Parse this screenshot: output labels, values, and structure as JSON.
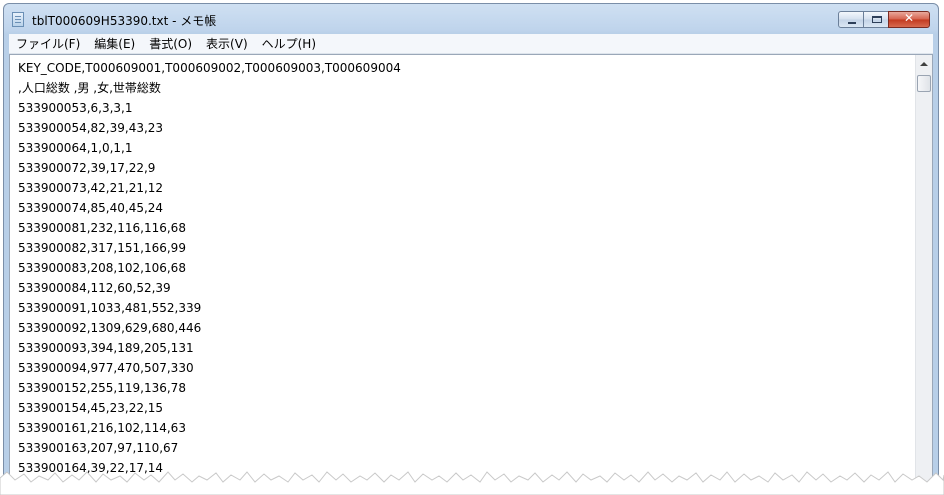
{
  "window": {
    "title": "tblT000609H53390.txt - メモ帳",
    "close_glyph": "✕"
  },
  "menu": [
    {
      "label": "ファイル(F)"
    },
    {
      "label": "編集(E)"
    },
    {
      "label": "書式(O)"
    },
    {
      "label": "表示(V)"
    },
    {
      "label": "ヘルプ(H)"
    }
  ],
  "document": {
    "lines": [
      "KEY_CODE,T000609001,T000609002,T000609003,T000609004",
      ",人口総数 ,男 ,女,世帯総数",
      "533900053,6,3,3,1",
      "533900054,82,39,43,23",
      "533900064,1,0,1,1",
      "533900072,39,17,22,9",
      "533900073,42,21,21,12",
      "533900074,85,40,45,24",
      "533900081,232,116,116,68",
      "533900082,317,151,166,99",
      "533900083,208,102,106,68",
      "533900084,112,60,52,39",
      "533900091,1033,481,552,339",
      "533900092,1309,629,680,446",
      "533900093,394,189,205,131",
      "533900094,977,470,507,330",
      "533900152,255,119,136,78",
      "533900154,45,23,22,15",
      "533900161,216,102,114,63",
      "533900163,207,97,110,67",
      "533900164,39,22,17,14"
    ]
  },
  "icons": {
    "app": "notepad-icon",
    "minimize": "minimize-icon",
    "maximize": "maximize-icon",
    "close": "close-icon",
    "scroll_up": "scroll-up-arrow-icon"
  },
  "colors": {
    "frame": "#b8cfe8",
    "close_button": "#c2391f",
    "text": "#000000"
  }
}
